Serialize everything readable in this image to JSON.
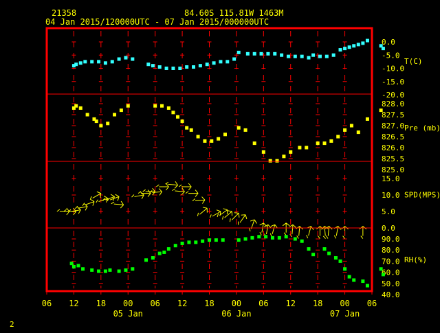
{
  "header": {
    "station": "21358",
    "coords": "84.60S  115.81W  1463M",
    "period": "04 Jan 2015/120000UTC - 07 Jan 2015/000000UTC"
  },
  "footer_label": "2",
  "colors": {
    "background": "#000000",
    "frame": "#ff0000",
    "grid": "#ff0000",
    "axis_text": "#ffff00",
    "temperature": "#33ffff",
    "pressure": "#ffff00",
    "wind": "#ffff00",
    "rh": "#00ff00"
  },
  "chart_data": {
    "type": "scatter",
    "x_axis": {
      "unit": "hours from 04 Jan 2015 00 UTC",
      "range": [
        6,
        78
      ],
      "ticks": [
        6,
        12,
        18,
        24,
        30,
        36,
        42,
        48,
        54,
        60,
        66,
        72,
        78
      ],
      "tick_labels": [
        "06",
        "12",
        "18",
        "00",
        "06",
        "12",
        "18",
        "00",
        "06",
        "12",
        "18",
        "00",
        "06"
      ],
      "day_labels": [
        {
          "x": 24,
          "label": "05 Jan"
        },
        {
          "x": 48,
          "label": "06 Jan"
        },
        {
          "x": 72,
          "label": "07 Jan"
        }
      ]
    },
    "panels": [
      {
        "id": "temperature",
        "label": "T(C)",
        "ylim": [
          -20,
          5
        ],
        "ticks": [
          0,
          -5,
          -10,
          -15,
          -20
        ],
        "tick_labels": [
          "0.0",
          "-5.0",
          "-10.0",
          "-15.0",
          "-20.0"
        ],
        "points": [
          [
            12.0,
            -9.0
          ],
          [
            12.5,
            -8.5
          ],
          [
            13.5,
            -8.0
          ],
          [
            14.5,
            -7.5
          ],
          [
            16.0,
            -7.5
          ],
          [
            17.5,
            -7.5
          ],
          [
            19.0,
            -8.0
          ],
          [
            20.5,
            -7.5
          ],
          [
            22.0,
            -6.5
          ],
          [
            23.5,
            -6.0
          ],
          [
            25.0,
            -6.5
          ],
          [
            28.5,
            -8.5
          ],
          [
            29.5,
            -9.0
          ],
          [
            31.0,
            -9.5
          ],
          [
            32.5,
            -10.0
          ],
          [
            34.0,
            -10.0
          ],
          [
            35.5,
            -10.0
          ],
          [
            37.0,
            -9.5
          ],
          [
            38.5,
            -9.5
          ],
          [
            40.0,
            -9.0
          ],
          [
            41.5,
            -8.5
          ],
          [
            43.0,
            -8.0
          ],
          [
            44.5,
            -7.5
          ],
          [
            46.0,
            -7.5
          ],
          [
            47.5,
            -6.5
          ],
          [
            48.5,
            -4.0
          ],
          [
            50.5,
            -4.5
          ],
          [
            52.0,
            -4.5
          ],
          [
            53.5,
            -4.5
          ],
          [
            55.0,
            -4.5
          ],
          [
            56.5,
            -4.5
          ],
          [
            58.0,
            -5.0
          ],
          [
            59.5,
            -5.5
          ],
          [
            61.0,
            -5.5
          ],
          [
            62.5,
            -5.5
          ],
          [
            64.0,
            -6.0
          ],
          [
            65.0,
            -5.0
          ],
          [
            66.5,
            -5.5
          ],
          [
            68.0,
            -5.5
          ],
          [
            69.5,
            -5.0
          ],
          [
            71.0,
            -3.0
          ],
          [
            72.0,
            -2.5
          ],
          [
            73.0,
            -2.0
          ],
          [
            74.0,
            -1.5
          ],
          [
            75.0,
            -1.0
          ],
          [
            76.0,
            -0.5
          ],
          [
            77.0,
            0.5
          ],
          [
            80.0,
            -1.5
          ],
          [
            80.5,
            -2.5
          ]
        ]
      },
      {
        "id": "pressure",
        "label": "Pre (mb)",
        "ylim": [
          825.0,
          828.0
        ],
        "ticks": [
          828.0,
          827.5,
          827.0,
          826.5,
          826.0,
          825.5,
          825.0
        ],
        "tick_labels": [
          "828.0",
          "827.5",
          "827.0",
          "826.5",
          "826.0",
          "825.5",
          "825.0"
        ],
        "points": [
          [
            12.0,
            827.8
          ],
          [
            12.5,
            827.9
          ],
          [
            13.5,
            827.8
          ],
          [
            15.0,
            827.5
          ],
          [
            16.5,
            827.3
          ],
          [
            17.0,
            827.2
          ],
          [
            18.0,
            827.0
          ],
          [
            19.5,
            827.1
          ],
          [
            21.0,
            827.5
          ],
          [
            22.5,
            827.7
          ],
          [
            24.0,
            827.9
          ],
          [
            30.0,
            827.9
          ],
          [
            31.5,
            827.9
          ],
          [
            33.0,
            827.8
          ],
          [
            34.0,
            827.6
          ],
          [
            35.0,
            827.4
          ],
          [
            36.0,
            827.2
          ],
          [
            37.0,
            826.9
          ],
          [
            38.0,
            826.8
          ],
          [
            39.5,
            826.5
          ],
          [
            41.0,
            826.3
          ],
          [
            42.5,
            826.3
          ],
          [
            44.0,
            826.4
          ],
          [
            45.5,
            826.6
          ],
          [
            48.5,
            826.9
          ],
          [
            50.0,
            826.8
          ],
          [
            52.0,
            826.2
          ],
          [
            54.0,
            825.8
          ],
          [
            55.5,
            825.4
          ],
          [
            57.0,
            825.4
          ],
          [
            58.5,
            825.6
          ],
          [
            60.0,
            825.8
          ],
          [
            62.0,
            826.0
          ],
          [
            63.5,
            826.0
          ],
          [
            66.0,
            826.2
          ],
          [
            67.5,
            826.2
          ],
          [
            69.0,
            826.3
          ],
          [
            70.5,
            826.5
          ],
          [
            72.0,
            826.8
          ],
          [
            73.5,
            827.0
          ],
          [
            75.0,
            826.7
          ],
          [
            77.0,
            827.3
          ],
          [
            80.0,
            827.7
          ]
        ]
      },
      {
        "id": "wind",
        "label": "SPD(MPS)",
        "ylim": [
          0,
          15
        ],
        "ticks": [
          15,
          10,
          5,
          0
        ],
        "tick_labels": [
          "15.0",
          "10.0",
          "5.0",
          "0.0"
        ],
        "barbs": [
          [
            11.0,
            5.0,
            270
          ],
          [
            12.5,
            5.0,
            270
          ],
          [
            13.5,
            5.5,
            260
          ],
          [
            15.0,
            6.5,
            260
          ],
          [
            16.5,
            8.0,
            250
          ],
          [
            18.0,
            10.5,
            240
          ],
          [
            19.5,
            9.0,
            250
          ],
          [
            21.0,
            9.5,
            250
          ],
          [
            22.0,
            9.5,
            250
          ],
          [
            23.0,
            7.0,
            275
          ],
          [
            27.5,
            10.0,
            260
          ],
          [
            29.0,
            10.5,
            270
          ],
          [
            30.0,
            11.0,
            270
          ],
          [
            31.5,
            11.0,
            265
          ],
          [
            33.0,
            12.5,
            270
          ],
          [
            35.0,
            13.0,
            275
          ],
          [
            36.5,
            11.0,
            275
          ],
          [
            38.0,
            12.5,
            270
          ],
          [
            39.5,
            10.5,
            270
          ],
          [
            41.0,
            8.5,
            265
          ],
          [
            41.5,
            6.0,
            230
          ],
          [
            44.5,
            5.0,
            240
          ],
          [
            46.0,
            5.5,
            235
          ],
          [
            47.0,
            5.0,
            230
          ],
          [
            48.5,
            4.5,
            225
          ],
          [
            50.0,
            4.0,
            215
          ],
          [
            52.0,
            2.5,
            200
          ],
          [
            54.0,
            1.5,
            190
          ],
          [
            55.0,
            1.0,
            190
          ],
          [
            56.5,
            1.0,
            195
          ],
          [
            59.0,
            1.5,
            180
          ],
          [
            60.5,
            1.0,
            185
          ],
          [
            62.0,
            0.5,
            185
          ],
          [
            64.5,
            0.5,
            195
          ],
          [
            66.5,
            0.5,
            180
          ],
          [
            67.5,
            0.5,
            175
          ],
          [
            68.5,
            0.5,
            185
          ],
          [
            70.5,
            0.5,
            190
          ],
          [
            72.0,
            0.5,
            180
          ],
          [
            76.0,
            0.5,
            180
          ]
        ]
      },
      {
        "id": "rh",
        "label": "RH(%)",
        "ylim": [
          40,
          95
        ],
        "ticks": [
          90,
          80,
          70,
          60,
          50,
          40
        ],
        "tick_labels": [
          "90.0",
          "80.0",
          "70.0",
          "60.0",
          "50.0",
          "40.0"
        ],
        "points": [
          [
            11.5,
            68
          ],
          [
            12.0,
            65
          ],
          [
            13.0,
            66
          ],
          [
            14.0,
            63
          ],
          [
            16.0,
            62
          ],
          [
            17.5,
            61
          ],
          [
            19.0,
            61
          ],
          [
            20.0,
            62
          ],
          [
            22.0,
            61
          ],
          [
            23.5,
            62
          ],
          [
            25.0,
            63
          ],
          [
            28.0,
            71
          ],
          [
            29.5,
            73
          ],
          [
            31.0,
            77
          ],
          [
            32.0,
            78
          ],
          [
            33.0,
            81
          ],
          [
            34.5,
            84
          ],
          [
            36.0,
            86
          ],
          [
            37.5,
            87
          ],
          [
            39.0,
            87
          ],
          [
            40.5,
            88
          ],
          [
            42.0,
            89
          ],
          [
            43.5,
            89
          ],
          [
            45.0,
            89
          ],
          [
            48.5,
            89
          ],
          [
            50.0,
            90
          ],
          [
            51.5,
            91
          ],
          [
            53.0,
            92
          ],
          [
            54.5,
            92
          ],
          [
            56.0,
            91
          ],
          [
            57.5,
            91
          ],
          [
            59.0,
            92
          ],
          [
            61.0,
            90
          ],
          [
            62.5,
            88
          ],
          [
            64.0,
            81
          ],
          [
            65.0,
            76
          ],
          [
            67.5,
            81
          ],
          [
            68.5,
            77
          ],
          [
            70.0,
            73
          ],
          [
            71.0,
            70
          ],
          [
            72.0,
            63
          ],
          [
            73.0,
            56
          ],
          [
            74.0,
            53
          ],
          [
            76.0,
            52
          ],
          [
            77.0,
            48
          ],
          [
            80.0,
            63
          ],
          [
            80.5,
            58
          ]
        ]
      }
    ]
  }
}
